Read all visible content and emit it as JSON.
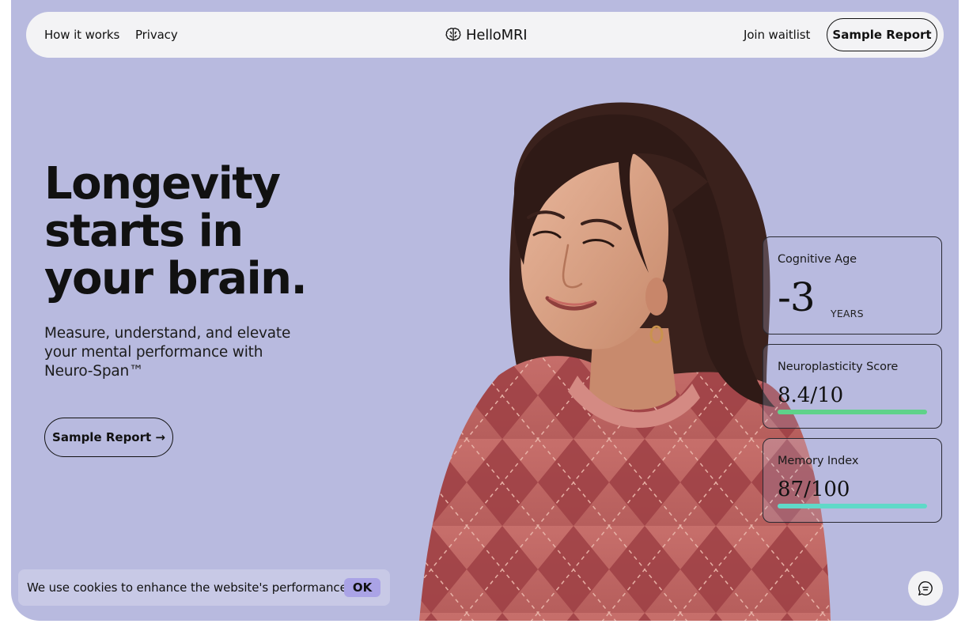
{
  "nav": {
    "links_left": [
      "How it works",
      "Privacy"
    ],
    "logo_text": "HelloMRI",
    "logo_icon": "brain-icon",
    "join_label": "Join waitlist",
    "cta_label": "Sample Report"
  },
  "hero": {
    "headline_lines": [
      "Longevity",
      "starts in",
      "your brain."
    ],
    "subtitle": "Measure, understand, and elevate your mental performance with Neuro-Span™",
    "cta_label": "Sample Report →"
  },
  "metrics": {
    "cognitive_age": {
      "label": "Cognitive Age",
      "value": "-3",
      "unit": "YEARS"
    },
    "neuroplasticity": {
      "label": "Neuroplasticity Score",
      "value": "8.4/10",
      "fraction": 0.84,
      "color": "#5fd28a"
    },
    "memory": {
      "label": "Memory Index",
      "value": "87/100",
      "fraction": 0.87,
      "color": "#5fd9c8"
    }
  },
  "cookie": {
    "text": "We use cookies to enhance the website's performance.",
    "ok_label": "OK"
  },
  "chat": {
    "icon": "chat-icon"
  },
  "colors": {
    "hero_bg": "#b8badf",
    "nav_bg": "#f3f3f5",
    "cookie_ok_bg": "#aaa3e6"
  }
}
